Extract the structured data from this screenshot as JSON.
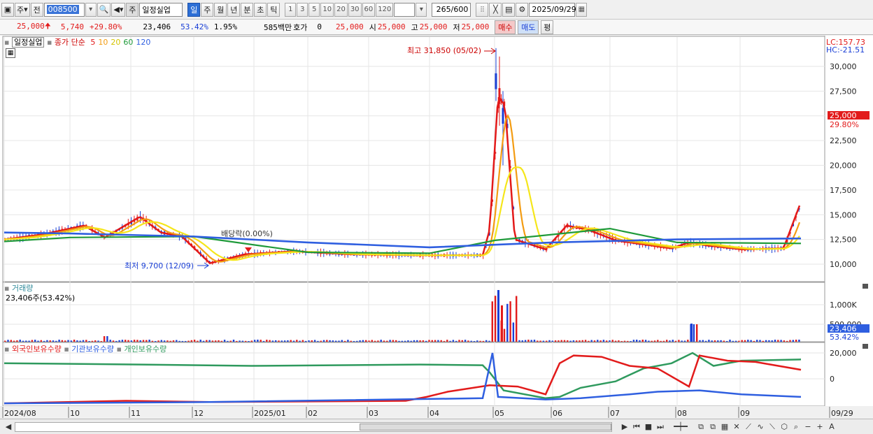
{
  "toolbar": {
    "period_label": "주",
    "prev_label": "전",
    "code_value": "008500",
    "name_badge": "주",
    "stock_name": "일정실업",
    "period_buttons": [
      "일",
      "주",
      "월",
      "년",
      "분",
      "초",
      "틱"
    ],
    "active_period": "일",
    "interval_buttons": [
      "1",
      "3",
      "5",
      "10",
      "20",
      "30",
      "60",
      "120"
    ],
    "count_value": "265",
    "count_total": "/600",
    "date_value": "2025/09/29"
  },
  "quote": {
    "price": "25,000",
    "change": "5,740",
    "change_pct": "+29.80%",
    "volume": "23,406",
    "volume_ratio": "53.42%",
    "turnover": "1.95%",
    "amount": "585백만",
    "hoga_label": "호가",
    "hoga_value": "0",
    "hoga_price": "25,000",
    "open_label": "시",
    "open_value": "25,000",
    "high_label": "고",
    "high_value": "25,000",
    "low_label": "저",
    "low_value": "25,000",
    "buy_label": "매수",
    "sell_label": "매도",
    "avg_label": "평"
  },
  "price_panel": {
    "name_label": "일정실업",
    "ma_label": "종가 단순",
    "ma_periods": [
      "5",
      "10",
      "20",
      "60",
      "120"
    ],
    "lc_label": "LC:157.73",
    "hc_label": "HC:-21.51",
    "high_annotation": "최고 31,850 (05/02)",
    "low_annotation": "최저 9,700 (12/09)",
    "dividend_annotation": "배당락(0.00%)",
    "last_price_tag": "25,000",
    "last_pct_tag": "29.80%"
  },
  "volume_panel": {
    "title": "거래량",
    "summary": "23,406주(53.42%)",
    "last_volume_tag": "23,406",
    "last_ratio_tag": "53.42%"
  },
  "holding_panel": {
    "foreign_label": "외국인보유수량",
    "inst_label": "기관보유수량",
    "indiv_label": "개인보유수량"
  },
  "time_axis": [
    "2024/08",
    "10",
    "11",
    "12",
    "2025/01",
    "02",
    "03",
    "04",
    "05",
    "06",
    "07",
    "08",
    "09",
    "09/29"
  ],
  "colors": {
    "up": "#e21b1b",
    "down": "#1a3fd6",
    "ma5": "#e31919",
    "ma10": "#f39c12",
    "ma20": "#f5e61a",
    "ma60": "#1f9a3a",
    "ma120": "#2f5fe0",
    "foreign": "#e21b1b",
    "inst": "#2f5fe0",
    "indiv": "#2f9a5e"
  },
  "chart_data": [
    {
      "type": "line",
      "title": "",
      "series": [
        {
          "name": "5",
          "x": [
            "2024/08",
            "2024/09",
            "2024/10",
            "2024/11",
            "2024/12",
            "2025/01",
            "2025/02",
            "2025/03",
            "2025/04",
            "2025/05",
            "2025/05",
            "2025/06",
            "2025/07",
            "2025/08",
            "2025/09",
            "2025/09/29"
          ],
          "values": [
            12500,
            13100,
            13700,
            14800,
            10100,
            11000,
            11000,
            10900,
            10900,
            26000,
            11600,
            13900,
            12400,
            12100,
            11500,
            16300
          ]
        },
        {
          "name": "60",
          "x": [
            "2024/08",
            "2024/10",
            "2024/12",
            "2025/02",
            "2025/04",
            "2025/05",
            "2025/07",
            "2025/08",
            "2025/09"
          ],
          "values": [
            12300,
            12700,
            12800,
            11200,
            11100,
            12400,
            13600,
            12200,
            12100
          ]
        },
        {
          "name": "120",
          "x": [
            "2024/08",
            "2024/10",
            "2024/12",
            "2025/02",
            "2025/04",
            "2025/06",
            "2025/08",
            "2025/09"
          ],
          "values": [
            13200,
            13100,
            12800,
            12200,
            11700,
            12200,
            12500,
            12600
          ]
        }
      ],
      "y_ticks": [
        "30,000",
        "27,500",
        "25,000",
        "22,500",
        "20,000",
        "17,500",
        "15,000",
        "12,500",
        "10,000"
      ],
      "ylim": [
        8500,
        32500
      ]
    },
    {
      "type": "bar",
      "title": "",
      "y_ticks": [
        "1,000K",
        "500,000"
      ],
      "ylim": [
        0,
        1300000
      ]
    },
    {
      "type": "line",
      "title": "",
      "y_ticks": [
        "20,000",
        "0"
      ]
    }
  ]
}
